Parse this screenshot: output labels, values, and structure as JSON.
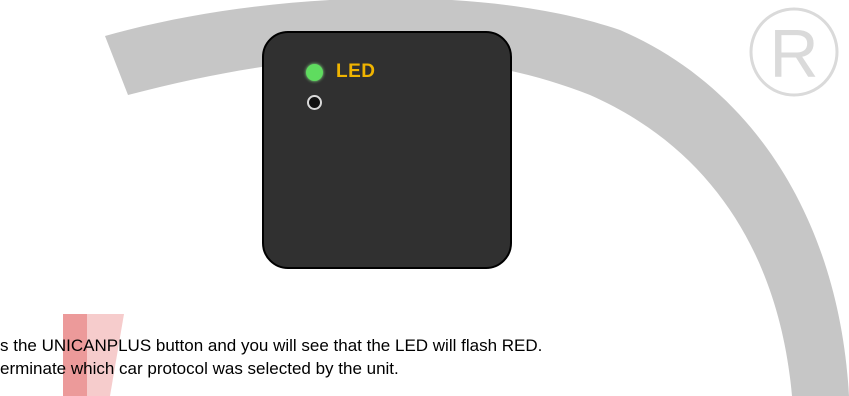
{
  "device": {
    "led_label": "LED",
    "led_color": "#5fdc5f",
    "label_color": "#f0b400"
  },
  "instructions": {
    "line1": "s the UNICANPLUS button and you will see that the LED will flash RED.",
    "line2": "erminate which car protocol was selected by the unit."
  },
  "watermark": {
    "registered_mark": "R"
  }
}
